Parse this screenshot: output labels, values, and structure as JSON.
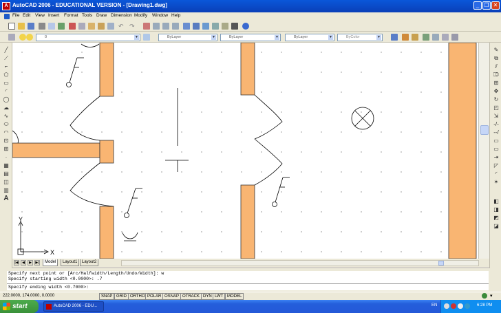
{
  "window": {
    "title": "AutoCAD 2006 - EDUCATIONAL VERSION - [Drawing1.dwg]",
    "app_icon_label": "A",
    "buttons": {
      "minimize": "_",
      "restore": "❐",
      "close": "✕"
    }
  },
  "menu": {
    "items": [
      "File",
      "Edit",
      "View",
      "Insert",
      "Format",
      "Tools",
      "Draw",
      "Dimension",
      "Modify",
      "Window",
      "Help"
    ]
  },
  "layers_toolbar": {
    "layer_value": "0",
    "color_value": "ByLayer",
    "linetype_value": "ByLayer",
    "lineweight_value": "ByLayer",
    "plotstyle_value": "ByColor"
  },
  "layout_tabs": {
    "nav": [
      "|◀",
      "◀",
      "▶",
      "▶|"
    ],
    "tabs": [
      "Model",
      "Layout1",
      "Layout2"
    ],
    "active": "Model"
  },
  "ucs": {
    "x_label": "X",
    "y_label": "Y"
  },
  "command": {
    "history": [
      "Specify next point or [Arc/Halfwidth/Length/Undo/Width]: w",
      "Specify starting width <0.0000>: .7"
    ],
    "current": "Specify ending width <0.7000>:"
  },
  "status": {
    "coordinates": "222.0000, 174.0000, 0.0000",
    "toggles": [
      "SNAP",
      "GRID",
      "ORTHO",
      "POLAR",
      "OSNAP",
      "OTRACK",
      "DYN",
      "LWT",
      "MODEL"
    ]
  },
  "taskbar": {
    "start_label": "start",
    "task_item": "AutoCAD 2006 - EDU...",
    "language": "EN",
    "clock": "6:28 PM"
  },
  "colors": {
    "wall_fill": "#f9b572",
    "canvas": "#ffffff",
    "titlebar": "#0a47c8"
  }
}
